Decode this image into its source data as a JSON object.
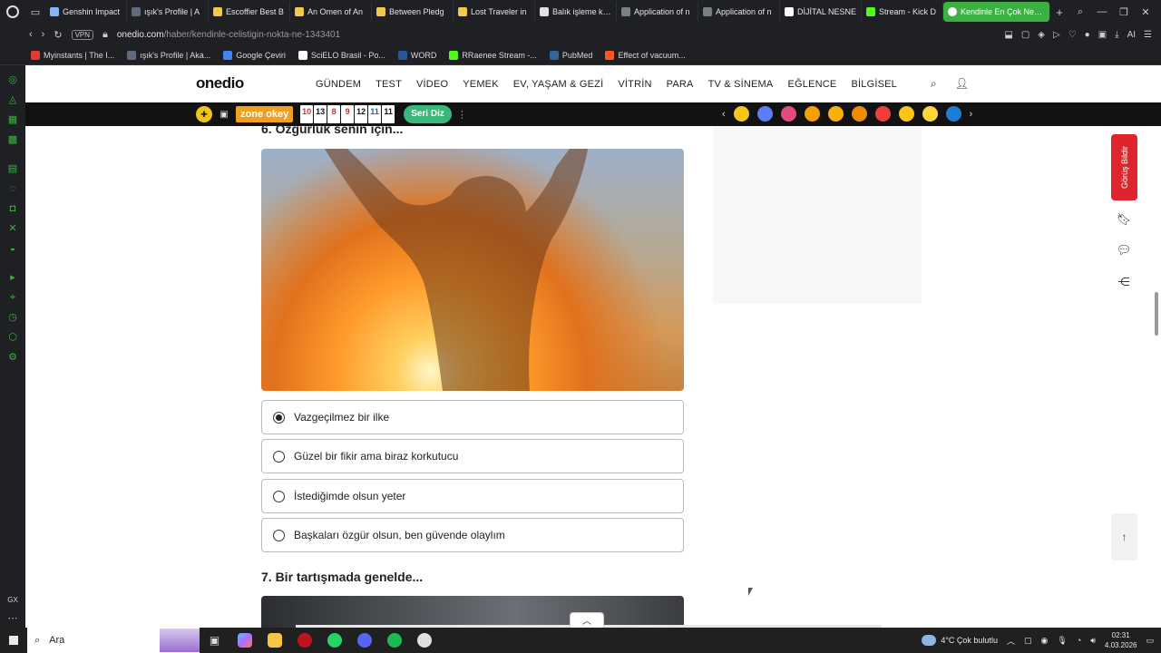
{
  "browser": {
    "tabs": [
      {
        "label": "Genshin Impact",
        "color": "#8ab4f8"
      },
      {
        "label": "ışık's Profile | A",
        "color": "#5f6b7a"
      },
      {
        "label": "Escoffier Best B",
        "color": "#f2c94c"
      },
      {
        "label": "An Omen of An",
        "color": "#f2c94c"
      },
      {
        "label": "Between Pledg",
        "color": "#f2c94c"
      },
      {
        "label": "Lost Traveler in",
        "color": "#f2c94c"
      },
      {
        "label": "Balık işleme kon",
        "color": "#e0e0e0"
      },
      {
        "label": "Application of n",
        "color": "#7a7f87"
      },
      {
        "label": "Application of n",
        "color": "#7a7f87"
      },
      {
        "label": "DİJİTAL NESNE",
        "color": "#ffffff"
      },
      {
        "label": "Stream - Kick D",
        "color": "#53fc18"
      }
    ],
    "active_tab": "Kendinle En Çok Nerede T",
    "url_domain": "onedio.com",
    "url_path": "/haber/kendinle-celistigin-nokta-ne-1343401",
    "vpn_label": "VPN",
    "addr_right_ai": "AI",
    "bookmarks": [
      {
        "label": "Myinstants | The I...",
        "color": "#e53935"
      },
      {
        "label": "ışık's Profile | Aka...",
        "color": "#5f6b7a"
      },
      {
        "label": "Google Çeviri",
        "color": "#4285f4"
      },
      {
        "label": "SciELO Brasil - Po...",
        "color": "#ffffff"
      },
      {
        "label": "WORD",
        "color": "#2b579a"
      },
      {
        "label": "RRaenee Stream -...",
        "color": "#53fc18"
      },
      {
        "label": "PubMed",
        "color": "#326599"
      },
      {
        "label": "Effect of vacuum...",
        "color": "#ff5722"
      }
    ]
  },
  "site": {
    "logo": "onedio",
    "nav": [
      "GÜNDEM",
      "TEST",
      "VİDEO",
      "YEMEK",
      "EV, YAŞAM & GEZİ",
      "VİTRİN",
      "PARA",
      "TV & SİNEMA",
      "EĞLENCE",
      "BİLGİSEL"
    ],
    "zone_label": "zone okey",
    "zone_numbers": [
      {
        "n": "10",
        "color": "#d32f2f"
      },
      {
        "n": "13",
        "color": "#111111"
      },
      {
        "n": "8",
        "color": "#d32f2f"
      },
      {
        "n": "9",
        "color": "#d32f2f"
      },
      {
        "n": "12",
        "color": "#111111"
      },
      {
        "n": "11",
        "color": "#1565c0"
      },
      {
        "n": "11",
        "color": "#111111"
      }
    ],
    "seri_label": "Seri Diz",
    "emoji_colors": [
      "#f5c518",
      "#5c7cfa",
      "#e64980",
      "#f59f00",
      "#fab005",
      "#f08c00",
      "#f03e3e",
      "#fcc419",
      "#ffd43b",
      "#1c7ed6"
    ]
  },
  "quiz": {
    "question6": "6. Özgürlük senin için...",
    "options": [
      {
        "label": "Vazgeçilmez bir ilke",
        "checked": true
      },
      {
        "label": "Güzel bir fikir ama biraz korkutucu",
        "checked": false
      },
      {
        "label": "İstediğimde olsun yeter",
        "checked": false
      },
      {
        "label": "Başkaları özgür olsun, ben güvende olaylım",
        "checked": false
      }
    ],
    "question7": "7. Bir tartışmada genelde..."
  },
  "side_tools": {
    "feedback_label": "Görüş Bildir"
  },
  "taskbar": {
    "search_placeholder": "Ara",
    "weather": "4°C  Çok bulutlu",
    "time": "02:31",
    "date": "4.03.2026"
  }
}
